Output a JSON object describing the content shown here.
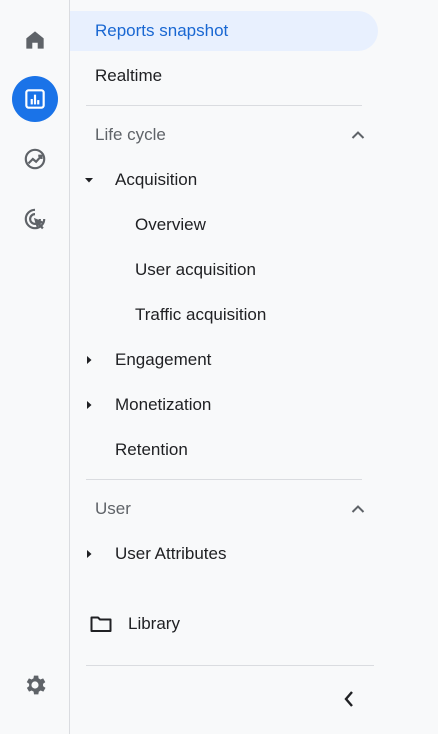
{
  "rail": {
    "items": [
      {
        "icon": "home-icon"
      },
      {
        "icon": "reports-icon"
      },
      {
        "icon": "explore-icon"
      },
      {
        "icon": "advertising-icon"
      },
      {
        "icon": "settings-icon"
      }
    ],
    "active_color": "#1a73e8"
  },
  "nav": {
    "reports_snapshot": "Reports snapshot",
    "realtime": "Realtime",
    "life_cycle": {
      "label": "Life cycle",
      "acquisition": {
        "label": "Acquisition",
        "children": [
          "Overview",
          "User acquisition",
          "Traffic acquisition"
        ]
      },
      "engagement": "Engagement",
      "monetization": "Monetization",
      "retention": "Retention"
    },
    "user": {
      "label": "User",
      "user_attributes": "User Attributes"
    },
    "library": "Library"
  }
}
